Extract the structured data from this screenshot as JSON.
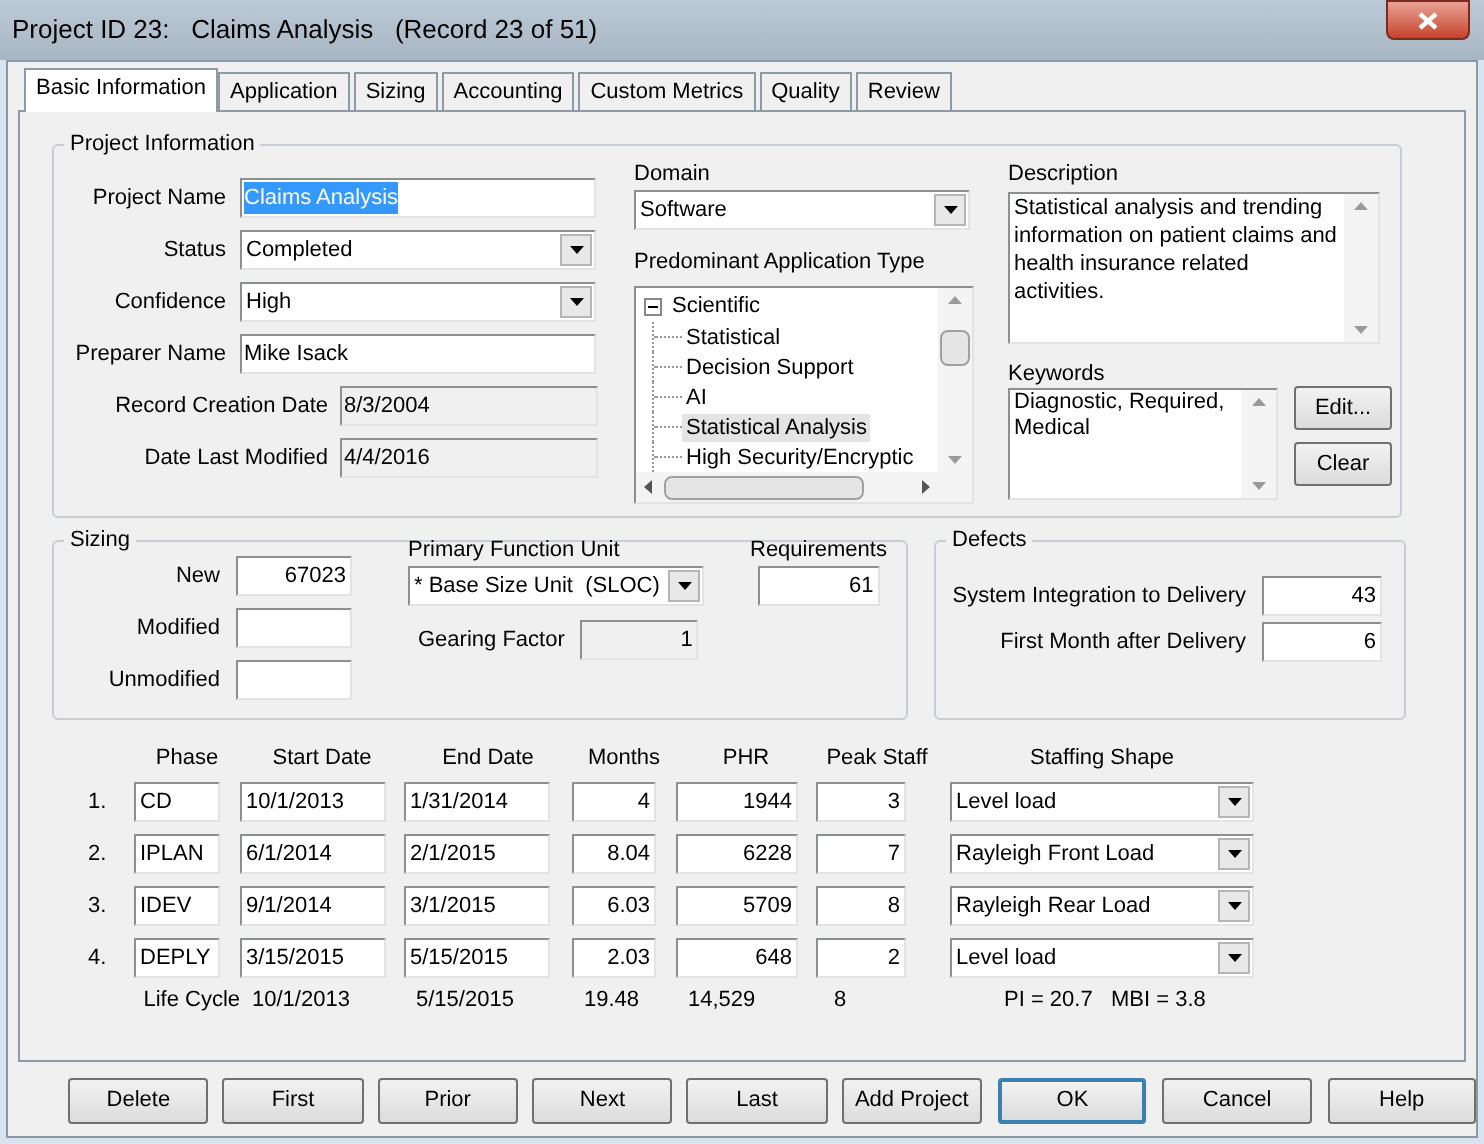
{
  "window": {
    "title": "Project ID 23:   Claims Analysis   (Record 23 of 51)"
  },
  "tabs": [
    {
      "label": "Basic Information",
      "selected": true
    },
    {
      "label": "Application",
      "selected": false
    },
    {
      "label": "Sizing",
      "selected": false
    },
    {
      "label": "Accounting",
      "selected": false
    },
    {
      "label": "Custom Metrics",
      "selected": false
    },
    {
      "label": "Quality",
      "selected": false
    },
    {
      "label": "Review",
      "selected": false
    }
  ],
  "project_information": {
    "title": "Project Information",
    "fields": [
      {
        "kind": "text",
        "label": "Project Name",
        "value": "Claims Analysis",
        "highlighted": true
      },
      {
        "kind": "dropdown",
        "label": "Status",
        "value": "Completed",
        "highlighted": false
      },
      {
        "kind": "dropdown",
        "label": "Confidence",
        "value": "High",
        "highlighted": false
      },
      {
        "kind": "text",
        "label": "Preparer Name",
        "value": "Mike Isack",
        "highlighted": false
      },
      {
        "kind": "readonly",
        "label": "Record Creation Date",
        "value": "8/3/2004",
        "highlighted": false
      },
      {
        "kind": "readonly",
        "label": "Date Last Modified",
        "value": "4/4/2016",
        "highlighted": false
      }
    ],
    "domain": {
      "label": "Domain",
      "value": "Software"
    },
    "application_type": {
      "label": "Predominant Application Type",
      "tree": {
        "label": "Scientific",
        "expanded": true,
        "children": [
          {
            "label": "Statistical",
            "selected": false
          },
          {
            "label": "Decision Support",
            "selected": false
          },
          {
            "label": "AI",
            "selected": false
          },
          {
            "label": "Statistical Analysis",
            "selected": true
          },
          {
            "label": "High Security/Encryptic",
            "selected": false
          }
        ]
      }
    },
    "description": {
      "label": "Description",
      "value": "Statistical analysis and trending information on patient claims and health insurance related activities."
    },
    "keywords": {
      "label": "Keywords",
      "value": "Diagnostic, Required, Medical",
      "buttons": [
        "Edit...",
        "Clear"
      ]
    }
  },
  "sizing": {
    "title": "Sizing",
    "fields": [
      {
        "label": "New",
        "value": "67023"
      },
      {
        "label": "Modified"
      },
      {
        "label": "Unmodified"
      }
    ],
    "primary_function_unit": {
      "label": "Primary Function Unit",
      "value": "* Base Size Unit  (SLOC)"
    },
    "gearing_factor": {
      "label": "Gearing Factor",
      "value": "1"
    },
    "requirements": {
      "label": "Requirements",
      "value": "61"
    }
  },
  "defects": {
    "title": "Defects",
    "fields": [
      {
        "label": "System Integration to Delivery",
        "value": "43"
      },
      {
        "label": "First Month after Delivery",
        "value": "6"
      }
    ]
  },
  "phases": {
    "columns": [
      "Phase",
      "Start Date",
      "End Date",
      "Months",
      "PHR",
      "Peak Staff",
      "Staffing Shape"
    ],
    "rows": [
      {
        "number": "1.",
        "phase": "CD",
        "start": "10/1/2013",
        "end": "1/31/2014",
        "months": "4",
        "phr": "1944",
        "peak_staff": "3",
        "staffing_shape": "Level load"
      },
      {
        "number": "2.",
        "phase": "IPLAN",
        "start": "6/1/2014",
        "end": "2/1/2015",
        "months": "8.04",
        "phr": "6228",
        "peak_staff": "7",
        "staffing_shape": "Rayleigh Front Load"
      },
      {
        "number": "3.",
        "phase": "IDEV",
        "start": "9/1/2014",
        "end": "3/1/2015",
        "months": "6.03",
        "phr": "5709",
        "peak_staff": "8",
        "staffing_shape": "Rayleigh Rear Load"
      },
      {
        "number": "4.",
        "phase": "DEPLY",
        "start": "3/15/2015",
        "end": "5/15/2015",
        "months": "2.03",
        "phr": "648",
        "peak_staff": "2",
        "staffing_shape": "Level load"
      }
    ],
    "life_cycle": {
      "label": "Life Cycle",
      "start": "10/1/2013",
      "end": "5/15/2015",
      "months": "19.48",
      "phr": "14,529",
      "peak_staff": "8",
      "indices": "PI = 20.7   MBI = 3.8"
    }
  },
  "buttons": [
    {
      "label": "Delete",
      "default": false
    },
    {
      "label": "First",
      "default": false
    },
    {
      "label": "Prior",
      "default": false
    },
    {
      "label": "Next",
      "default": false
    },
    {
      "label": "Last",
      "default": false
    },
    {
      "label": "Add Project",
      "default": false
    },
    {
      "label": "OK",
      "default": true
    },
    {
      "label": "Cancel",
      "default": false
    },
    {
      "label": "Help",
      "default": false
    }
  ]
}
